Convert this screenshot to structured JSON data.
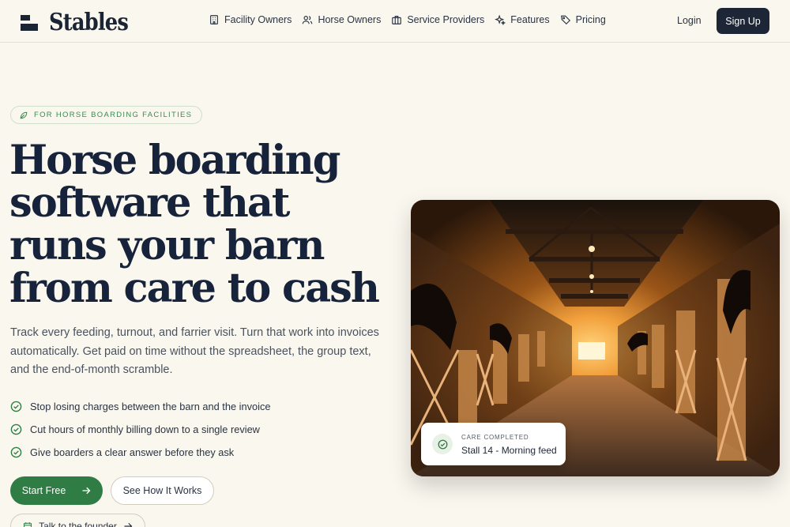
{
  "nav": {
    "logo_text": "Stables",
    "links": [
      {
        "label": "Facility Owners",
        "icon": "building-icon"
      },
      {
        "label": "Horse Owners",
        "icon": "users-icon"
      },
      {
        "label": "Service Providers",
        "icon": "briefcase-icon"
      },
      {
        "label": "Features",
        "icon": "sparkles-icon"
      },
      {
        "label": "Pricing",
        "icon": "tag-icon"
      }
    ],
    "login_label": "Login",
    "signup_label": "Sign Up"
  },
  "hero": {
    "badge": "FOR HORSE BOARDING FACILITIES",
    "headline": "Horse boarding software that runs your barn from care to cash",
    "subtext": "Track every feeding, turnout, and farrier visit. Turn that work into invoices automatically. Get paid on time without the spreadsheet, the group text, and the end-of-month scramble.",
    "checks": [
      "Stop losing charges between the barn and the invoice",
      "Cut hours of monthly billing down to a single review",
      "Give boarders a clear answer before they ask"
    ],
    "start_button": "Start Free",
    "see_button": "See How It Works",
    "founder_button": "Talk to the founder"
  },
  "care_card": {
    "label": "CARE COMPLETED",
    "value": "Stall 14 - Morning feed"
  },
  "colors": {
    "background": "#faf7ef",
    "primary_dark": "#1c2636",
    "accent_green": "#2f7d45"
  }
}
